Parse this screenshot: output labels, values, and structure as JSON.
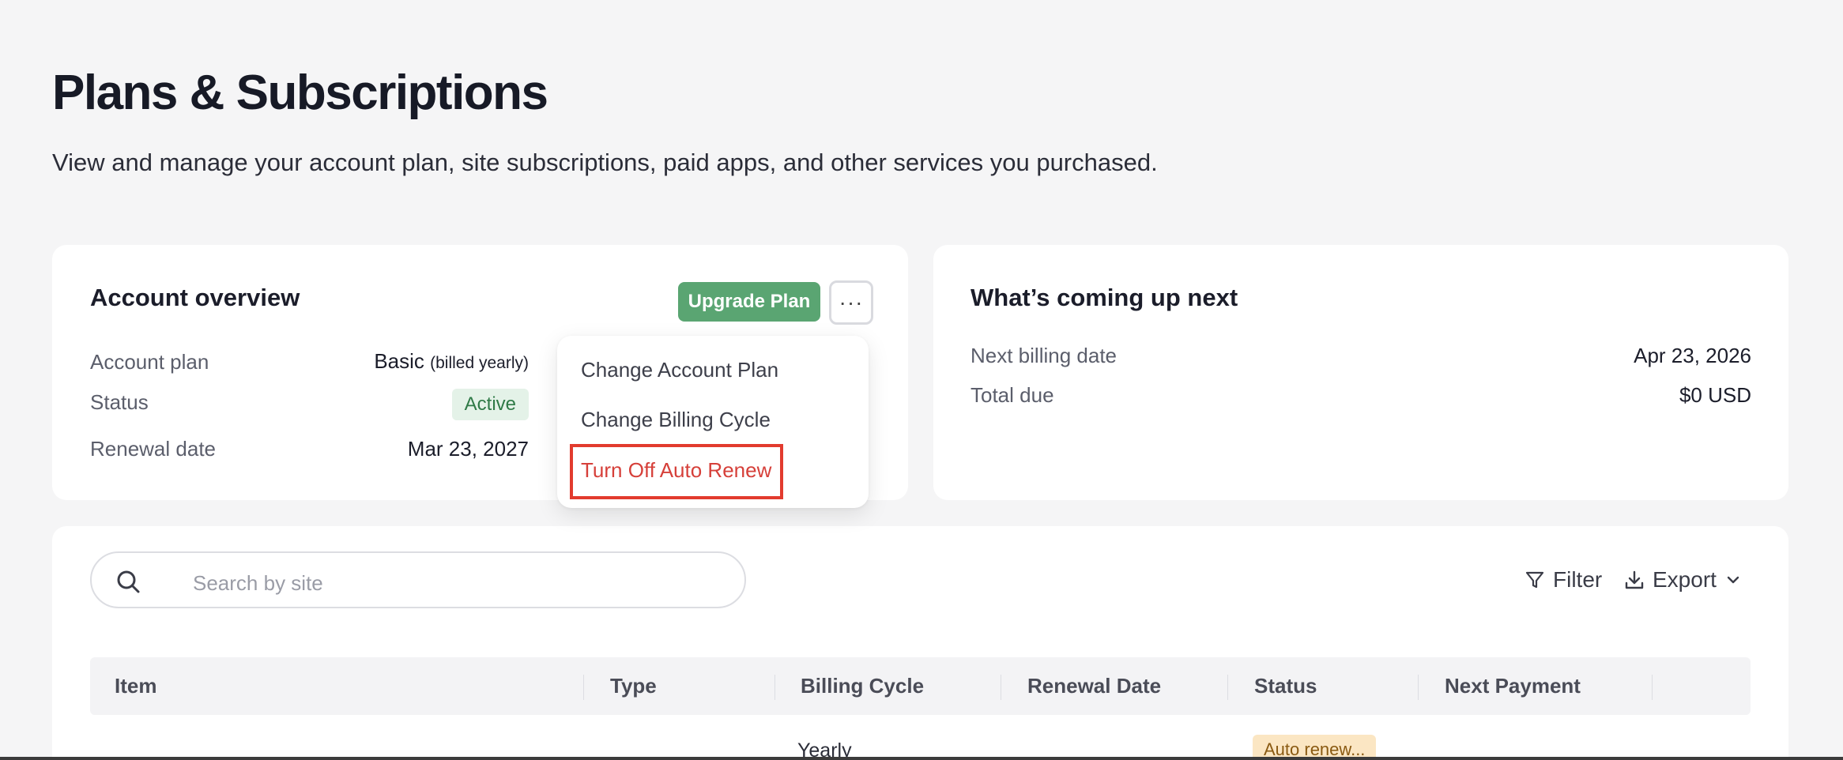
{
  "page": {
    "title": "Plans & Subscriptions",
    "subtitle": "View and manage your account plan, site subscriptions, paid apps, and other services you purchased."
  },
  "account_overview": {
    "title": "Account overview",
    "upgrade_label": "Upgrade Plan",
    "more_label": "···",
    "plan_label": "Account plan",
    "plan_value": "Basic",
    "plan_note": "(billed yearly)",
    "status_label": "Status",
    "status_value": "Active",
    "renewal_label": "Renewal date",
    "renewal_value": "Mar 23, 2027"
  },
  "menu": {
    "items": [
      "Change Account Plan",
      "Change Billing Cycle",
      "Turn Off Auto Renew"
    ]
  },
  "upcoming": {
    "title": "What’s coming up next",
    "billing_label": "Next billing date",
    "billing_value": "Apr 23, 2026",
    "total_label": "Total due",
    "total_value": "$0 USD"
  },
  "subscriptions": {
    "search_placeholder": "Search by site",
    "filter_label": "Filter",
    "export_label": "Export",
    "columns": [
      "Item",
      "Type",
      "Billing Cycle",
      "Renewal Date",
      "Status",
      "Next Payment"
    ],
    "rows": [
      {
        "billing_cycle": "Yearly",
        "status": "Auto renew..."
      }
    ]
  },
  "colors": {
    "accent_green": "#5aa572",
    "danger_red": "#d6403a",
    "highlight_red": "#e23b2e"
  },
  "icons": [
    "search-icon",
    "filter-icon",
    "download-icon",
    "chevron-down-icon",
    "more-horizontal-icon"
  ]
}
